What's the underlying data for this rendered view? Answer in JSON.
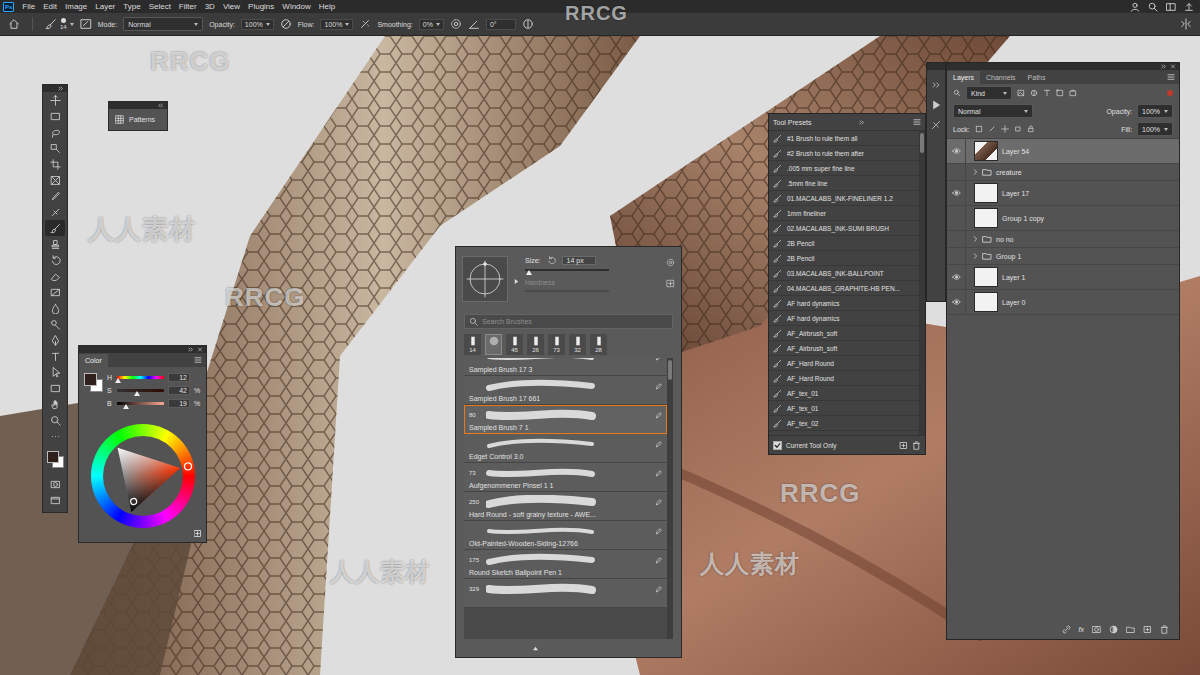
{
  "menu": {
    "logo": "Ps",
    "items": [
      "File",
      "Edit",
      "Image",
      "Layer",
      "Type",
      "Select",
      "Filter",
      "3D",
      "View",
      "Plugins",
      "Window",
      "Help"
    ]
  },
  "options_bar": {
    "brush_size": "14",
    "mode_label": "Mode:",
    "mode": "Normal",
    "opacity_label": "Opacity:",
    "opacity": "100%",
    "flow_label": "Flow:",
    "flow": "100%",
    "smoothing_label": "Smoothing:",
    "smoothing": "0%",
    "angle": "0°"
  },
  "toolbar": {
    "tools": [
      {
        "selected": false
      },
      {
        "selected": false
      },
      {
        "selected": false
      },
      {
        "selected": false
      },
      {
        "selected": false
      },
      {
        "selected": false
      },
      {
        "selected": false
      },
      {
        "selected": false
      },
      {
        "selected": true
      },
      {
        "selected": false
      },
      {
        "selected": false
      },
      {
        "selected": false
      },
      {
        "selected": false
      },
      {
        "selected": false
      },
      {
        "selected": false
      },
      {
        "selected": false
      },
      {
        "selected": false
      },
      {
        "selected": false
      },
      {
        "selected": false
      },
      {
        "selected": false
      },
      {
        "selected": false
      },
      {
        "selected": false
      }
    ]
  },
  "patterns_panel": {
    "title": "Patterns"
  },
  "color_panel": {
    "title": "Color",
    "channels": [
      {
        "name": "H",
        "value": "12",
        "level": 0.03
      },
      {
        "name": "S",
        "value": "42",
        "unit": "%",
        "level": 0.42
      },
      {
        "name": "B",
        "value": "19",
        "unit": "%",
        "level": 0.19
      }
    ]
  },
  "brush_picker": {
    "size_label": "Size:",
    "size": "14 px",
    "size_level": 0.05,
    "hardness_label": "Hardness",
    "hardness_disabled": true,
    "search_placeholder": "Search Brushes",
    "recent": [
      {
        "size": "14",
        "selected": false
      },
      {
        "size": "",
        "selected": true
      },
      {
        "size": "45",
        "selected": false
      },
      {
        "size": "26",
        "selected": false
      },
      {
        "size": "73",
        "selected": false
      },
      {
        "size": "32",
        "selected": false
      },
      {
        "size": "28",
        "selected": false
      }
    ],
    "brushes": [
      {
        "size": "",
        "name": "Sampled Brush 17 3",
        "selected": false
      },
      {
        "size": "",
        "name": "Sampled Brush 17 661",
        "selected": false
      },
      {
        "size": "80",
        "name": "Sampled Brush 7 1",
        "selected": true
      },
      {
        "size": "",
        "name": "Edget Control 3.0",
        "selected": false
      },
      {
        "size": "73",
        "name": "Aufgenommener Pinsel 1 1",
        "selected": false
      },
      {
        "size": "250",
        "name": "Hard Round - soft grainy texture - AWE...",
        "selected": false
      },
      {
        "size": "",
        "name": "Old-Painted-Wooden-Siding-12766",
        "selected": false
      },
      {
        "size": "175",
        "name": "Round Sketch Ballpoint Pen 1",
        "selected": false
      },
      {
        "size": "329",
        "name": "",
        "selected": false
      }
    ]
  },
  "tool_presets": {
    "title": "Tool Presets",
    "items": [
      "#1 Brush to rule them all",
      "#2 Brush to rule them after",
      ".005 mm super fine line",
      ".5mm fine line",
      "01.MACALABS_INK-FINELINER 1.2",
      "1mm fineliner",
      "02.MACALABS_INK-SUMI BRUSH",
      "2B Pencil",
      "2B Pencil",
      "03.MACALABS_INK-BALLPOINT",
      "04.MACALABS_GRAPHITE-HB PEN...",
      "AF hard dynamics",
      "AF hard dynamics",
      "AF_Airbrush_soft",
      "AF_Airbrush_soft",
      "AF_Hard Round",
      "AF_Hard Round",
      "AF_tex_01",
      "AF_tex_01",
      "AF_tex_02"
    ],
    "current_tool_only": {
      "label": "Current Tool Only",
      "checked": true
    }
  },
  "layers_panel": {
    "tabs": [
      {
        "label": "Layers",
        "selected": true
      },
      {
        "label": "Channels",
        "selected": false
      },
      {
        "label": "Paths",
        "selected": false
      }
    ],
    "filter": "Kind",
    "blend_mode": "Normal",
    "opacity_label": "Opacity:",
    "opacity": "100%",
    "lock_label": "Lock:",
    "fill_label": "Fill:",
    "fill": "100%",
    "layers": [
      {
        "name": "Layer 54",
        "kind": "layer",
        "visible": true,
        "selected": true
      },
      {
        "name": "creature",
        "kind": "group",
        "visible": false,
        "selected": false
      },
      {
        "name": "Layer 17",
        "kind": "layer",
        "visible": true,
        "selected": false
      },
      {
        "name": "Group 1 copy",
        "kind": "layer",
        "visible": false,
        "selected": false
      },
      {
        "name": "no no",
        "kind": "group",
        "visible": false,
        "selected": false
      },
      {
        "name": "Group 1",
        "kind": "group",
        "visible": false,
        "selected": false
      },
      {
        "name": "Layer 1",
        "kind": "layer",
        "visible": true,
        "selected": false
      },
      {
        "name": "Layer 0",
        "kind": "layer",
        "visible": true,
        "selected": false
      }
    ],
    "fx": "fx"
  },
  "watermarks": [
    "RRCG",
    "RRCG",
    "人人素材",
    "RRCG",
    "人人素材",
    "人人素材",
    "RRCG"
  ]
}
